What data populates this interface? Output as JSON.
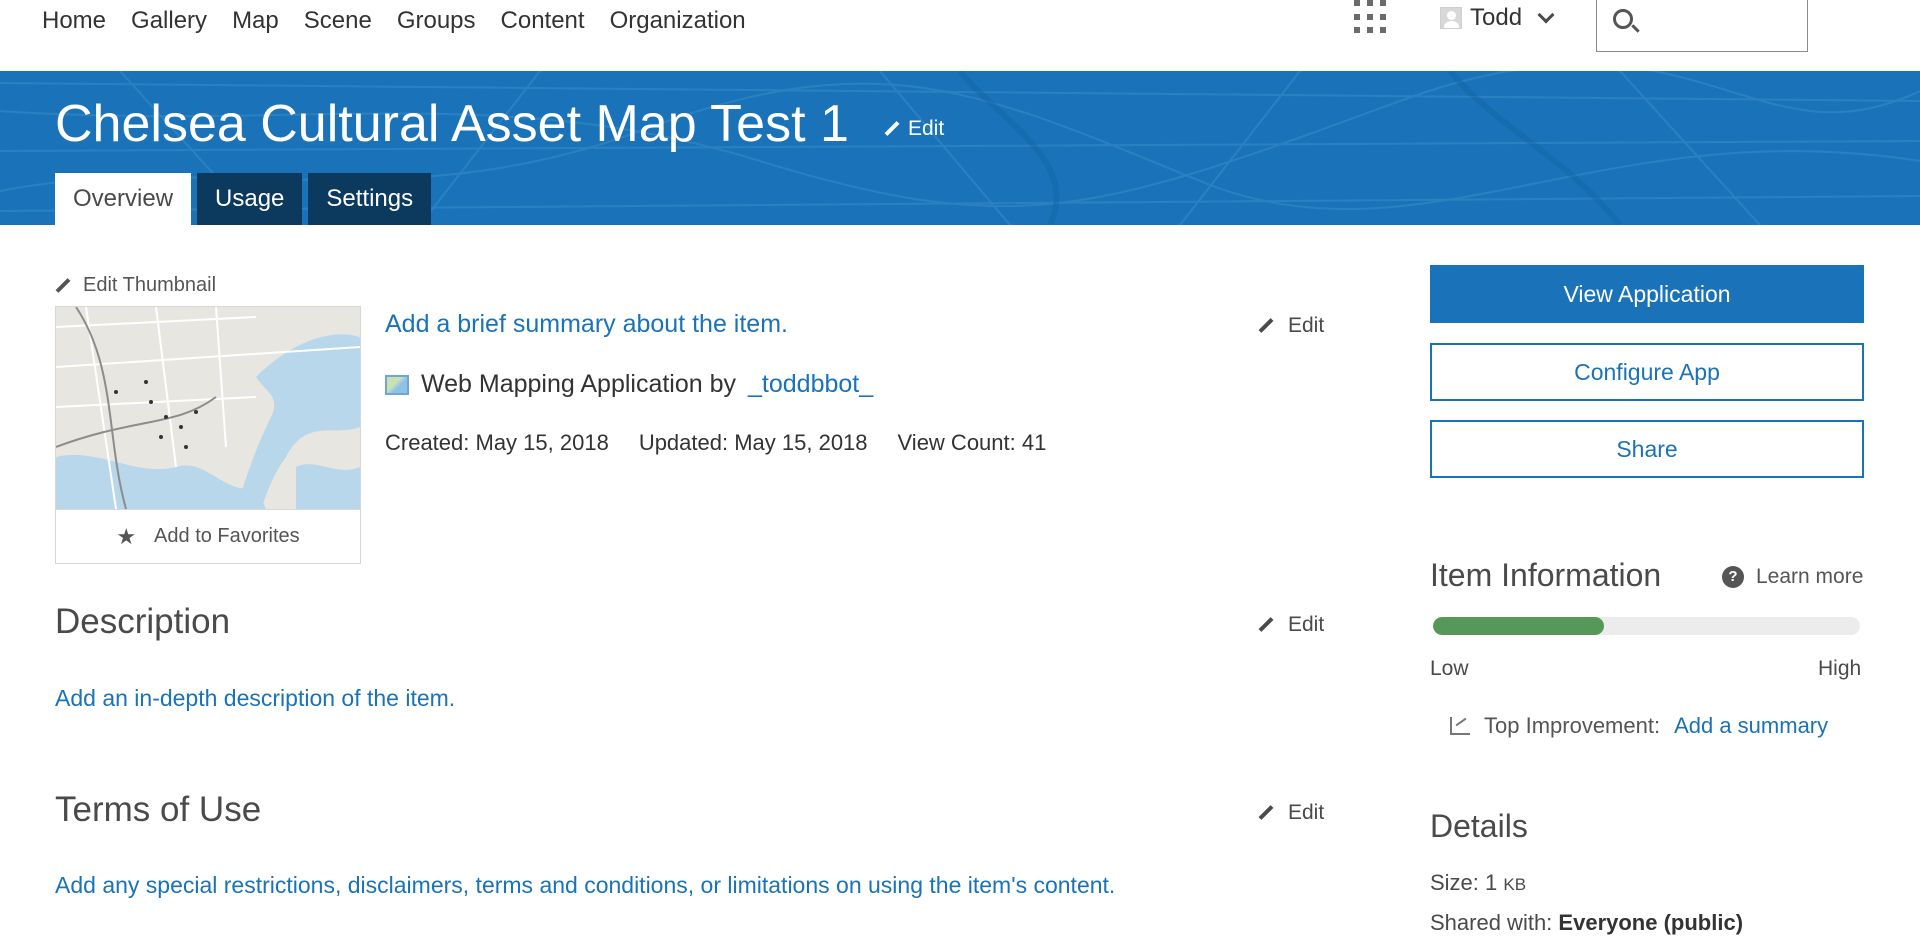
{
  "nav": {
    "links": [
      "Home",
      "Gallery",
      "Map",
      "Scene",
      "Groups",
      "Content",
      "Organization"
    ],
    "user_name": "Todd",
    "search_placeholder": ""
  },
  "header": {
    "title": "Chelsea Cultural Asset Map Test 1",
    "edit_label": "Edit",
    "tabs": [
      {
        "label": "Overview",
        "active": true
      },
      {
        "label": "Usage",
        "active": false
      },
      {
        "label": "Settings",
        "active": false
      }
    ]
  },
  "item": {
    "edit_thumbnail_label": "Edit Thumbnail",
    "add_favorites_label": "Add to Favorites",
    "summary_link": "Add a brief summary about the item.",
    "summary_edit_label": "Edit",
    "type_prefix": "Web Mapping Application by",
    "owner": "_toddbbot_",
    "created": "Created: May 15, 2018",
    "updated": "Updated: May 15, 2018",
    "view_count": "View Count: 41"
  },
  "description": {
    "heading": "Description",
    "edit_label": "Edit",
    "link": "Add an in-depth description of the item."
  },
  "terms": {
    "heading": "Terms of Use",
    "edit_label": "Edit",
    "link": "Add any special restrictions, disclaimers, terms and conditions, or limitations on using the item's content."
  },
  "sidebar": {
    "view_application": "View Application",
    "configure_app": "Configure App",
    "share": "Share",
    "info_heading": "Item Information",
    "learn_more": "Learn more",
    "info_level_percent": 40,
    "low_label": "Low",
    "high_label": "High",
    "top_improvement_label": "Top Improvement:",
    "top_improvement_link": "Add a summary",
    "details_heading": "Details",
    "size_label": "Size:",
    "size_value": "1",
    "size_unit": "KB",
    "shared_label": "Shared with:",
    "shared_value": "Everyone (public)"
  },
  "colors": {
    "brand_blue": "#1a73b8",
    "tab_dark": "#0b3a5e",
    "meter_green": "#55985a"
  },
  "icons": [
    "apps-grid-icon",
    "avatar-icon",
    "chevron-down-icon",
    "search-icon",
    "pencil-icon",
    "star-icon",
    "app-type-icon",
    "help-icon",
    "trend-icon"
  ]
}
